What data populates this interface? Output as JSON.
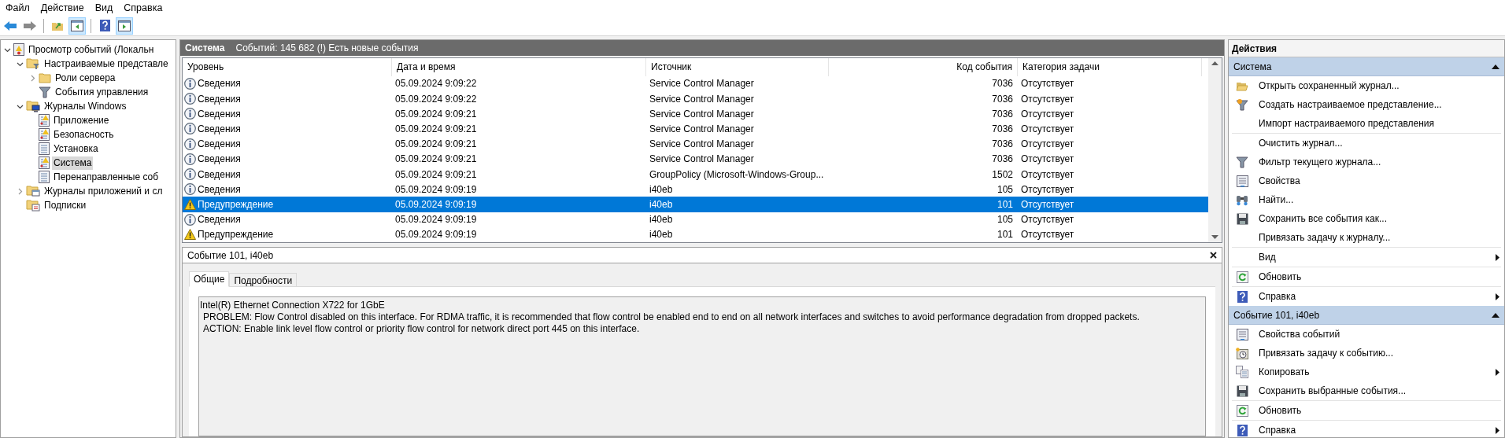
{
  "menu": [
    "Файл",
    "Действие",
    "Вид",
    "Справка"
  ],
  "toolbar": [
    {
      "kind": "back",
      "pressed": false
    },
    {
      "kind": "forward",
      "pressed": false
    },
    {
      "kind": "sep"
    },
    {
      "kind": "up",
      "pressed": false
    },
    {
      "kind": "tree",
      "pressed": true
    },
    {
      "kind": "sep"
    },
    {
      "kind": "help",
      "pressed": false
    },
    {
      "kind": "pane",
      "pressed": true
    }
  ],
  "tree": [
    {
      "label": "Просмотр событий (Локальн",
      "kind": "viewer",
      "expanded": true,
      "selected": false,
      "children": [
        {
          "label": "Настраиваемые представле",
          "kind": "folder-filter",
          "expanded": true,
          "selected": false,
          "children": [
            {
              "label": "Роли сервера",
              "kind": "folder",
              "expanded": false,
              "selected": false
            },
            {
              "label": "События управления",
              "kind": "filter",
              "selected": false
            }
          ]
        },
        {
          "label": "Журналы Windows",
          "kind": "folder-computer",
          "expanded": true,
          "selected": false,
          "children": [
            {
              "label": "Приложение",
              "kind": "log-warn",
              "selected": false
            },
            {
              "label": "Безопасность",
              "kind": "log-warn",
              "selected": false
            },
            {
              "label": "Установка",
              "kind": "log",
              "selected": false
            },
            {
              "label": "Система",
              "kind": "log-warn",
              "selected": true
            },
            {
              "label": "Перенаправленные соб",
              "kind": "log",
              "selected": false
            }
          ]
        },
        {
          "label": "Журналы приложений и сл",
          "kind": "folder-log",
          "expanded": false,
          "selected": false
        },
        {
          "label": "Подписки",
          "kind": "subscription",
          "selected": false
        }
      ]
    }
  ],
  "log": {
    "title": "Система",
    "summary": "Событий: 145 682 (!) Есть новые события"
  },
  "table": {
    "columns": [
      "Уровень",
      "Дата и время",
      "Источник",
      "Код события",
      "Категория задачи"
    ],
    "rows": [
      {
        "kind": "info",
        "cells": [
          "Сведения",
          "05.09.2024 9:09:22",
          "Service Control Manager",
          "7036",
          "Отсутствует"
        ],
        "selected": false
      },
      {
        "kind": "info",
        "cells": [
          "Сведения",
          "05.09.2024 9:09:22",
          "Service Control Manager",
          "7036",
          "Отсутствует"
        ],
        "selected": false
      },
      {
        "kind": "info",
        "cells": [
          "Сведения",
          "05.09.2024 9:09:21",
          "Service Control Manager",
          "7036",
          "Отсутствует"
        ],
        "selected": false
      },
      {
        "kind": "info",
        "cells": [
          "Сведения",
          "05.09.2024 9:09:21",
          "Service Control Manager",
          "7036",
          "Отсутствует"
        ],
        "selected": false
      },
      {
        "kind": "info",
        "cells": [
          "Сведения",
          "05.09.2024 9:09:21",
          "Service Control Manager",
          "7036",
          "Отсутствует"
        ],
        "selected": false
      },
      {
        "kind": "info",
        "cells": [
          "Сведения",
          "05.09.2024 9:09:21",
          "Service Control Manager",
          "7036",
          "Отсутствует"
        ],
        "selected": false
      },
      {
        "kind": "info",
        "cells": [
          "Сведения",
          "05.09.2024 9:09:21",
          "GroupPolicy (Microsoft-Windows-Group...",
          "1502",
          "Отсутствует"
        ],
        "selected": false
      },
      {
        "kind": "info",
        "cells": [
          "Сведения",
          "05.09.2024 9:09:19",
          "i40eb",
          "105",
          "Отсутствует"
        ],
        "selected": false
      },
      {
        "kind": "warning",
        "cells": [
          "Предупреждение",
          "05.09.2024 9:09:19",
          "i40eb",
          "101",
          "Отсутствует"
        ],
        "selected": true
      },
      {
        "kind": "info",
        "cells": [
          "Сведения",
          "05.09.2024 9:09:19",
          "i40eb",
          "105",
          "Отсутствует"
        ],
        "selected": false
      },
      {
        "kind": "warning",
        "cells": [
          "Предупреждение",
          "05.09.2024 9:09:19",
          "i40eb",
          "101",
          "Отсутствует"
        ],
        "selected": false
      }
    ]
  },
  "detail": {
    "title": "Событие 101, i40eb",
    "tabs": [
      {
        "label": "Общие",
        "selected": true
      },
      {
        "label": "Подробности",
        "selected": false
      }
    ],
    "lines": [
      "Intel(R) Ethernet Connection X722 for 1GbE",
      "PROBLEM: Flow Control disabled on this interface. For RDMA traffic, it is recommended that flow control be enabled end to end on all network interfaces and switches to avoid performance degradation from dropped packets.",
      "ACTION: Enable link level flow control or priority flow control for network direct port 445 on this interface."
    ]
  },
  "actions": {
    "title": "Действия",
    "groups": [
      {
        "title": "Система",
        "expanded": true,
        "sections": [
          [
            {
              "label": "Открыть сохраненный журнал...",
              "kind": "open"
            },
            {
              "label": "Создать настраиваемое представление...",
              "kind": "filter-new"
            },
            {
              "label": "Импорт настраиваемого представления"
            }
          ],
          [
            {
              "label": "Очистить журнал..."
            },
            {
              "label": "Фильтр текущего журнала...",
              "kind": "filter"
            },
            {
              "label": "Свойства",
              "kind": "properties"
            },
            {
              "label": "Найти...",
              "kind": "find"
            },
            {
              "label": "Сохранить все события как...",
              "kind": "save"
            },
            {
              "label": "Привязать задачу к журналу..."
            }
          ],
          [
            {
              "label": "Вид",
              "submenu": true
            }
          ],
          [
            {
              "label": "Обновить",
              "kind": "refresh"
            }
          ],
          [
            {
              "label": "Справка",
              "kind": "help",
              "submenu": true
            }
          ]
        ]
      },
      {
        "title": "Событие 101, i40eb",
        "expanded": true,
        "sections": [
          [
            {
              "label": "Свойства событий",
              "kind": "properties"
            },
            {
              "label": "Привязать задачу к событию...",
              "kind": "task"
            },
            {
              "label": "Копировать",
              "kind": "copy",
              "submenu": true
            },
            {
              "label": "Сохранить выбранные события...",
              "kind": "save"
            }
          ],
          [
            {
              "label": "Обновить",
              "kind": "refresh"
            }
          ],
          [
            {
              "label": "Справка",
              "kind": "help",
              "submenu": true
            }
          ]
        ]
      }
    ]
  }
}
